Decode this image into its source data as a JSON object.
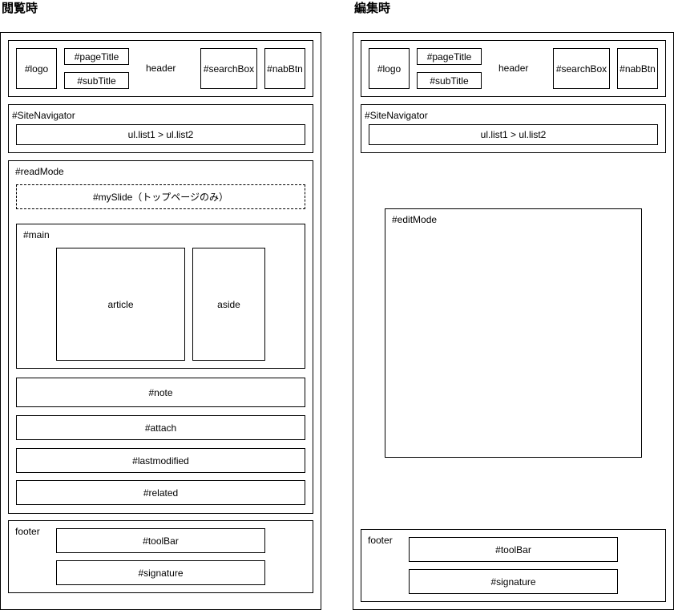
{
  "panels": {
    "read": {
      "title": "閲覧時",
      "header": {
        "label": "header",
        "logo": "#logo",
        "pageTitle": "#pageTitle",
        "subTitle": "#subTitle",
        "searchBox": "#searchBox",
        "nabBtn": "#nabBtn"
      },
      "siteNavigator": {
        "label": "#SiteNavigator",
        "list": "ul.list1 > ul.list2"
      },
      "readMode": {
        "label": "#readMode",
        "mySlide": "#mySlide（トップページのみ）",
        "main": {
          "label": "#main",
          "article": "article",
          "aside": "aside"
        },
        "note": "#note",
        "attach": "#attach",
        "lastmodified": "#lastmodified",
        "related": "#related"
      },
      "footer": {
        "label": "footer",
        "toolBar": "#toolBar",
        "signature": "#signature"
      }
    },
    "edit": {
      "title": "編集時",
      "header": {
        "label": "header",
        "logo": "#logo",
        "pageTitle": "#pageTitle",
        "subTitle": "#subTitle",
        "searchBox": "#searchBox",
        "nabBtn": "#nabBtn"
      },
      "siteNavigator": {
        "label": "#SiteNavigator",
        "list": "ul.list1 > ul.list2"
      },
      "editMode": {
        "label": "#editMode"
      },
      "footer": {
        "label": "footer",
        "toolBar": "#toolBar",
        "signature": "#signature"
      }
    }
  }
}
